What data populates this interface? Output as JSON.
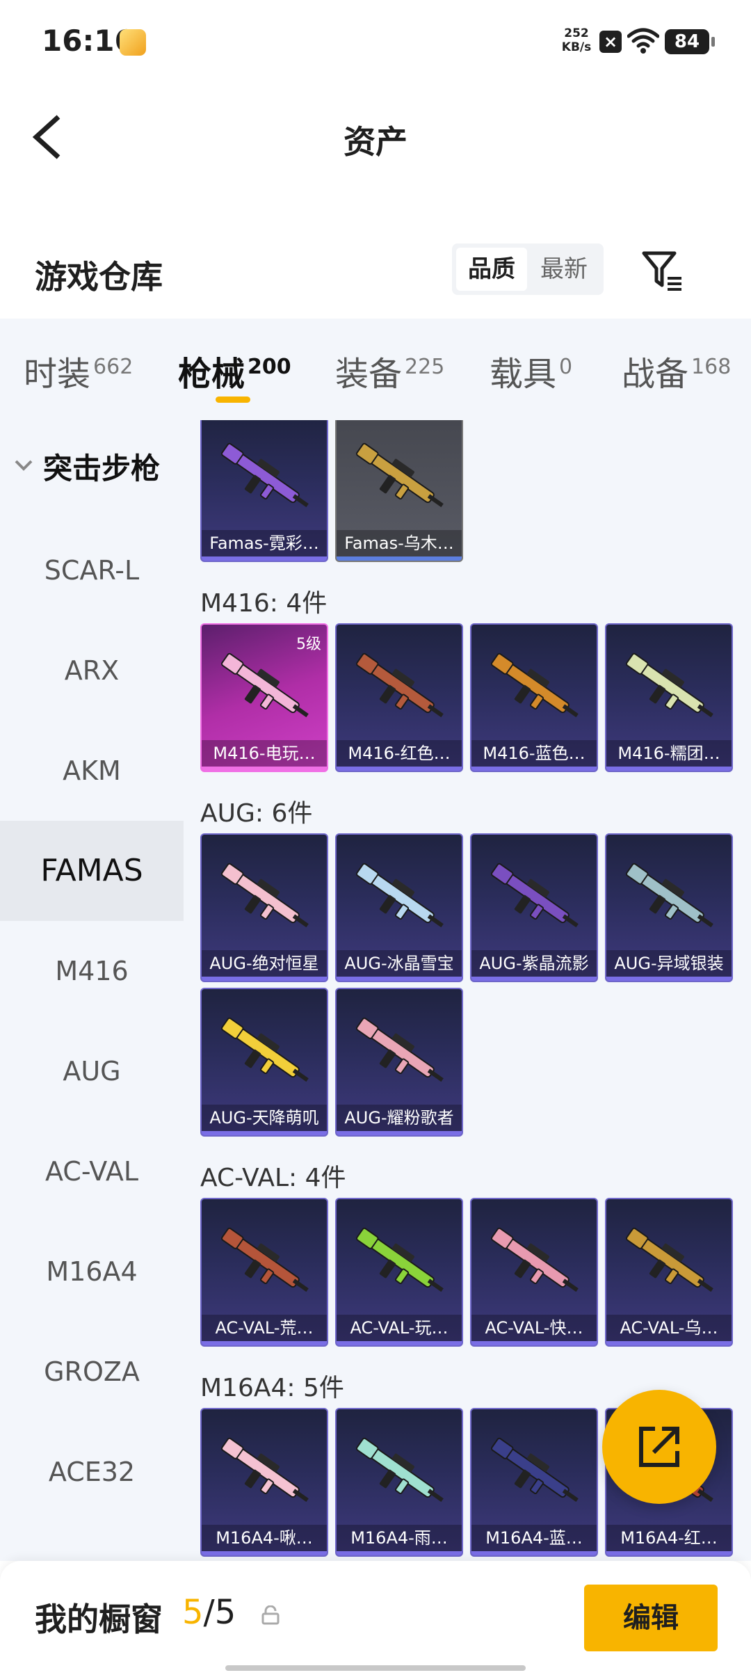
{
  "status_bar": {
    "time": "16:16",
    "app_badge": "拒手游戏",
    "net_speed_value": "252",
    "net_speed_unit": "KB/s",
    "battery": "84"
  },
  "header": {
    "title": "资产"
  },
  "section": {
    "title": "游戏仓库",
    "sort_options": [
      "品质",
      "最新"
    ],
    "active_sort": "品质"
  },
  "tabs": [
    {
      "label": "时装",
      "count": "662"
    },
    {
      "label": "枪械",
      "count": "200"
    },
    {
      "label": "装备",
      "count": "225"
    },
    {
      "label": "载具",
      "count": "0"
    },
    {
      "label": "战备",
      "count": "168"
    }
  ],
  "active_tab": "枪械",
  "sidebar": {
    "group": "突击步枪",
    "items": [
      "SCAR-L",
      "ARX",
      "AKM",
      "FAMAS",
      "M416",
      "AUG",
      "AC-VAL",
      "M16A4",
      "GROZA",
      "ACE32"
    ],
    "active": "FAMAS"
  },
  "groups": [
    {
      "title": "",
      "items": [
        {
          "label": "Famas-霓彩…",
          "gun_color": "#8d5bd6"
        },
        {
          "label": "Famas-乌木…",
          "gun_color": "#c9a040"
        }
      ]
    },
    {
      "title": "M416: 4件",
      "items": [
        {
          "label": "M416-电玩…",
          "level": "5级",
          "gun_color": "#f3b6d8"
        },
        {
          "label": "M416-红色…",
          "gun_color": "#b45a3c"
        },
        {
          "label": "M416-蓝色…",
          "gun_color": "#d48a2a"
        },
        {
          "label": "M416-糯团…",
          "gun_color": "#d9e3b0"
        }
      ]
    },
    {
      "title": "AUG: 6件",
      "items": [
        {
          "label": "AUG-绝对恒星",
          "gun_color": "#f4c0cf"
        },
        {
          "label": "AUG-冰晶雪宝",
          "gun_color": "#b8d8f0"
        },
        {
          "label": "AUG-紫晶流影",
          "gun_color": "#7a4fc0"
        },
        {
          "label": "AUG-异域银装",
          "gun_color": "#9fc0c8"
        },
        {
          "label": "AUG-天降萌叽",
          "gun_color": "#f2cf3a"
        },
        {
          "label": "AUG-耀粉歌者",
          "gun_color": "#e9a6b6"
        }
      ]
    },
    {
      "title": "AC-VAL: 4件",
      "items": [
        {
          "label": "AC-VAL-荒…",
          "gun_color": "#b5553a"
        },
        {
          "label": "AC-VAL-玩…",
          "gun_color": "#8ad33a"
        },
        {
          "label": "AC-VAL-快…",
          "gun_color": "#e89ab0"
        },
        {
          "label": "AC-VAL-乌…",
          "gun_color": "#c99a38"
        }
      ]
    },
    {
      "title": "M16A4: 5件",
      "items": [
        {
          "label": "M16A4-啾…",
          "gun_color": "#f5c2d2"
        },
        {
          "label": "M16A4-雨…",
          "gun_color": "#9fe0d0"
        },
        {
          "label": "M16A4-蓝…",
          "gun_color": "#3a3f8a"
        },
        {
          "label": "M16A4-红…",
          "gun_color": "#c0483a"
        }
      ]
    }
  ],
  "bottom": {
    "showcase_label": "我的橱窗",
    "current": "5",
    "separator": "/",
    "total": "5",
    "edit_label": "编辑"
  },
  "colors": {
    "accent": "#f8b400",
    "card_border": "#6e66c9",
    "tab_bg": "#f3f6fb"
  }
}
